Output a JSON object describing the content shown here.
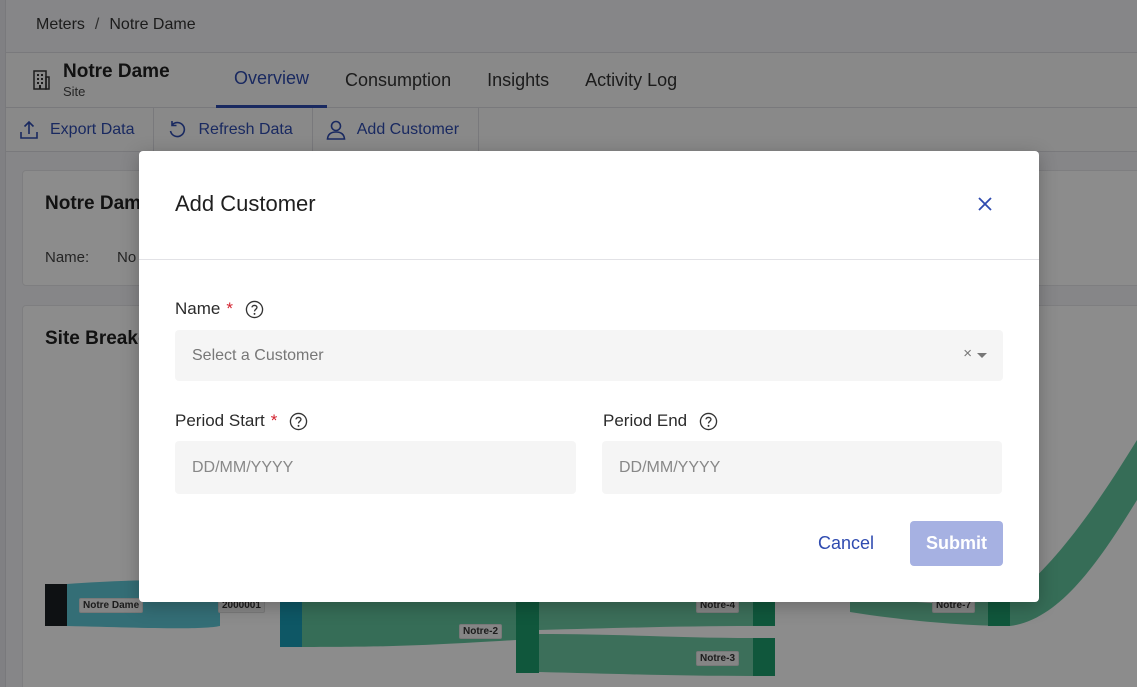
{
  "breadcrumb": {
    "root": "Meters",
    "separator": "/",
    "current": "Notre Dame"
  },
  "header": {
    "title": "Notre Dame",
    "subtitle": "Site",
    "icon": "building-icon"
  },
  "tabs": [
    {
      "label": "Overview",
      "active": true
    },
    {
      "label": "Consumption",
      "active": false
    },
    {
      "label": "Insights",
      "active": false
    },
    {
      "label": "Activity Log",
      "active": false
    }
  ],
  "toolbar": {
    "export_label": "Export Data",
    "refresh_label": "Refresh Data",
    "add_customer_label": "Add Customer"
  },
  "details_card": {
    "title": "Notre Dam",
    "name_label": "Name:",
    "name_value": "No"
  },
  "breakdown_card": {
    "title": "Site Breakd"
  },
  "sankey_labels": [
    "Notre Dame",
    "2000001",
    "Notre-2",
    "Notre-4",
    "Notre-3",
    "Notre-7"
  ],
  "modal": {
    "title": "Add Customer",
    "name_label": "Name",
    "required_marker": "*",
    "customer_placeholder": "Select a Customer",
    "clear_glyph": "×",
    "period_start_label": "Period Start",
    "period_end_label": "Period End",
    "date_placeholder": "DD/MM/YYYY",
    "cancel_label": "Cancel",
    "submit_label": "Submit"
  },
  "colors": {
    "accent": "#2f4bb0",
    "required": "#d21f2c",
    "submit_disabled": "#a6b1e2",
    "sankey_teal": "#2bb5c9",
    "sankey_green": "#2fb37e"
  }
}
